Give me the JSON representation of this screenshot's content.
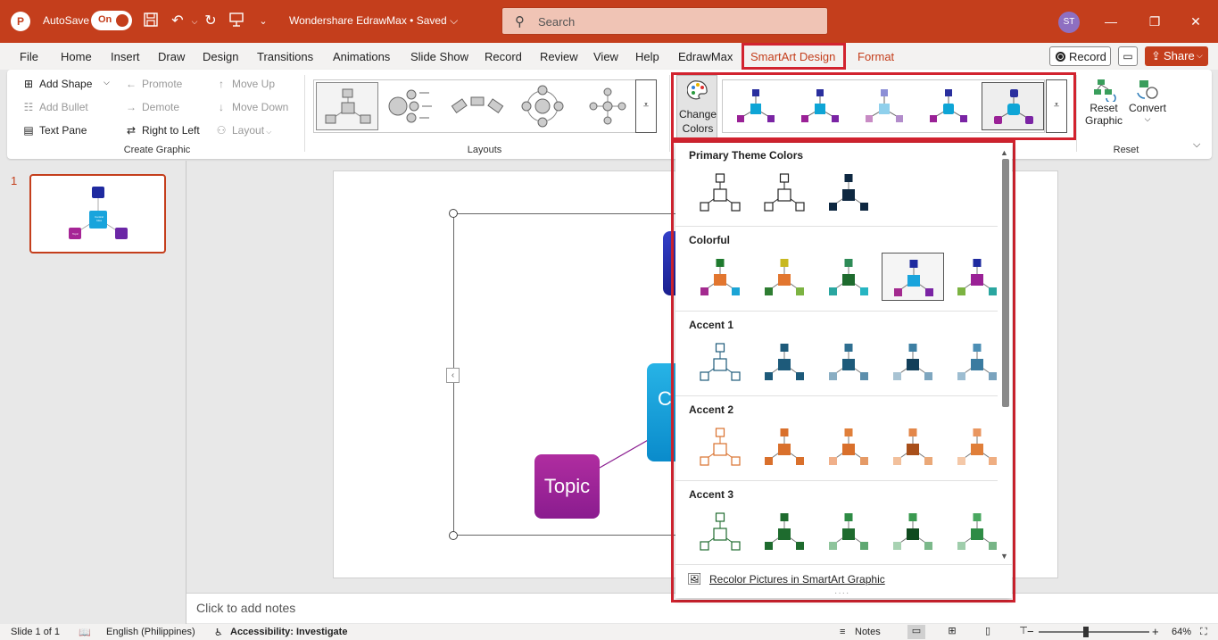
{
  "titlebar": {
    "app_icon": "P",
    "autosave_label": "AutoSave",
    "autosave_state": "On",
    "doc_title": "Wondershare EdrawMax • Saved ⌵",
    "search_placeholder": "Search",
    "avatar_initials": "ST",
    "icons": [
      "save-icon",
      "undo-icon",
      "redo-icon",
      "present-icon",
      "customize-qat-icon",
      "search-icon",
      "minimize-icon",
      "restore-icon",
      "close-icon"
    ]
  },
  "menu": {
    "tabs": [
      "File",
      "Home",
      "Insert",
      "Draw",
      "Design",
      "Transitions",
      "Animations",
      "Slide Show",
      "Record",
      "Review",
      "View",
      "Help",
      "EdrawMax",
      "SmartArt Design",
      "Format"
    ],
    "active_tab": "SmartArt Design",
    "record_label": "Record",
    "share_label": "Share"
  },
  "ribbon": {
    "create_graphic": {
      "add_shape": "Add Shape",
      "add_bullet": "Add Bullet",
      "text_pane": "Text Pane",
      "promote": "Promote",
      "demote": "Demote",
      "right_to_left": "Right to Left",
      "move_up": "Move Up",
      "move_down": "Move Down",
      "layout": "Layout",
      "group_label": "Create Graphic"
    },
    "layouts": {
      "group_label": "Layouts"
    },
    "smartart_styles": {
      "change_colors_line1": "Change",
      "change_colors_line2": "Colors"
    },
    "reset": {
      "reset_graphic_line1": "Reset",
      "reset_graphic_line2": "Graphic",
      "convert": "Convert",
      "group_label": "Reset"
    }
  },
  "colors": {
    "accent": "#c43e1c",
    "highlight": "#d2232f"
  },
  "color_dropdown": {
    "sections": [
      {
        "title": "Primary Theme Colors"
      },
      {
        "title": "Colorful"
      },
      {
        "title": "Accent 1"
      },
      {
        "title": "Accent 2"
      },
      {
        "title": "Accent 3"
      }
    ],
    "recolor_label": "Recolor Pictures in SmartArt Graphic"
  },
  "slides": {
    "current": "1",
    "thumb_center": "Central Idea",
    "thumb_topic": "Topic"
  },
  "canvas": {
    "topic_text": "Topic",
    "center_text": "C"
  },
  "notes_placeholder": "Click to add notes",
  "statusbar": {
    "slide_info": "Slide 1 of 1",
    "language": "English (Philippines)",
    "accessibility": "Accessibility: Investigate",
    "notes_label": "Notes",
    "zoom": "64%"
  }
}
